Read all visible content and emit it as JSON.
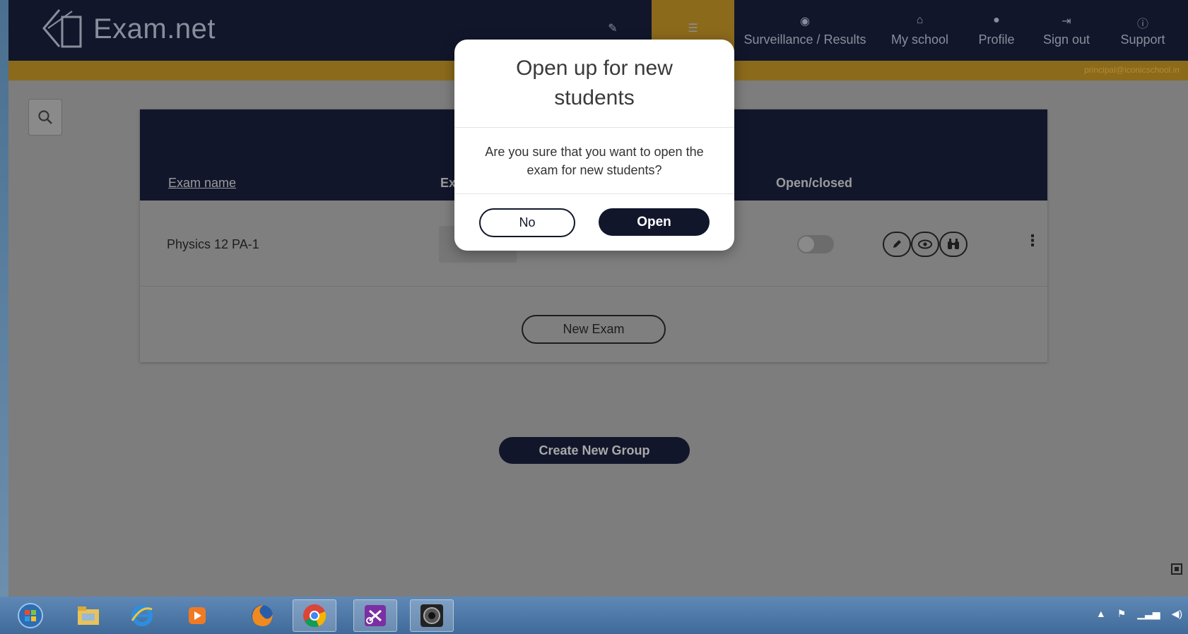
{
  "app": {
    "logo_text": "Exam.net",
    "user_email": "principal@iconicschool.in"
  },
  "nav": {
    "items": [
      {
        "label": "",
        "icon": "pencil-icon"
      },
      {
        "label": "",
        "icon": "list-icon",
        "active": true
      },
      {
        "label": "Surveillance / Results",
        "icon": "eye-icon"
      },
      {
        "label": "My school",
        "icon": "home-icon"
      },
      {
        "label": "Profile",
        "icon": "user-icon"
      },
      {
        "label": "Sign out",
        "icon": "sign-out-icon"
      },
      {
        "label": "Support",
        "icon": "help-icon"
      }
    ]
  },
  "table": {
    "headers": {
      "exam_name": "Exam name",
      "exam_key_partial": "Ex",
      "open_closed": "Open/closed"
    },
    "rows": [
      {
        "name": "Physics 12 PA-1",
        "open": false
      }
    ],
    "new_exam_label": "New Exam"
  },
  "create_group_label": "Create New Group",
  "modal": {
    "title": "Open up for new students",
    "body": "Are you sure that you want to open the exam for new students?",
    "no_label": "No",
    "open_label": "Open"
  },
  "taskbar": {
    "apps": [
      "start-orb-icon",
      "file-explorer-icon",
      "internet-explorer-icon",
      "media-player-icon",
      "firefox-icon",
      "chrome-icon",
      "snipping-tool-icon",
      "webcam-app-icon"
    ]
  },
  "colors": {
    "navy": "#11162b",
    "accent": "#e2a72c"
  }
}
